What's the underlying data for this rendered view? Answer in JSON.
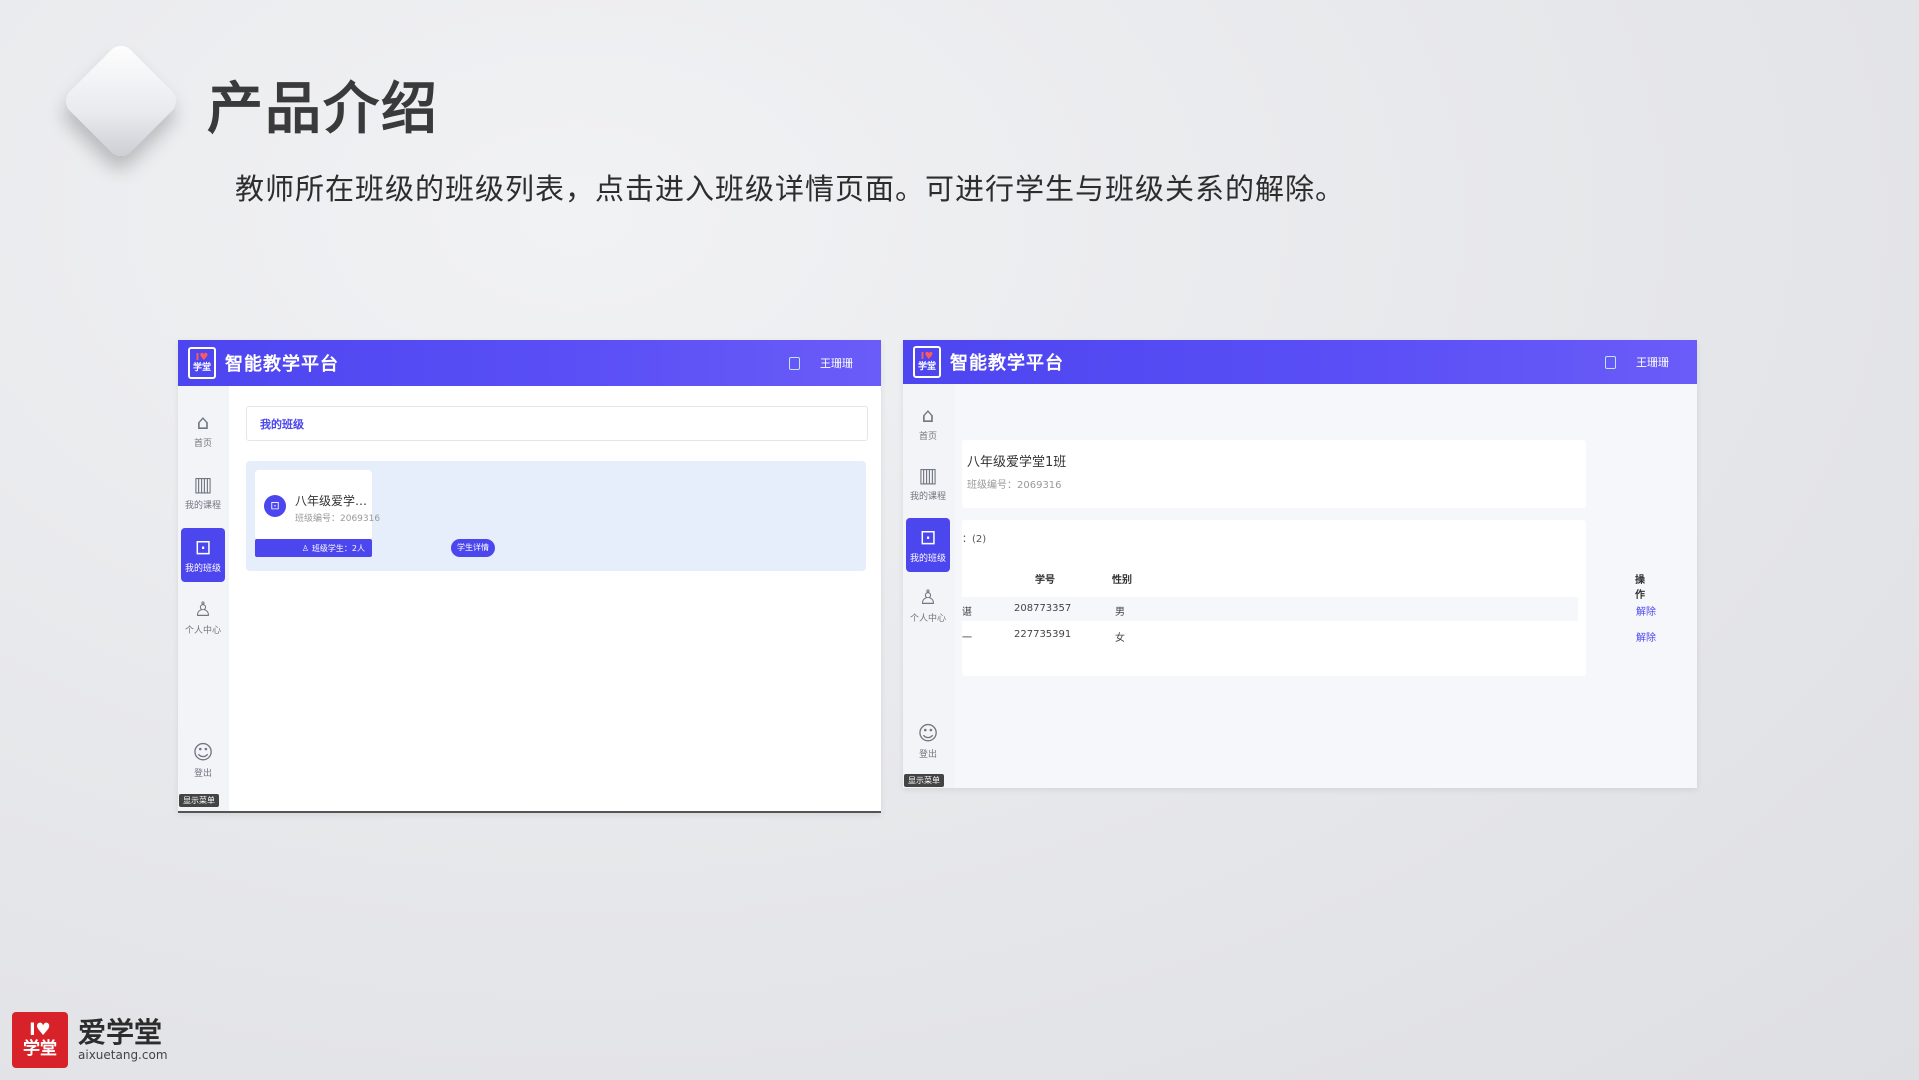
{
  "slide": {
    "title": "产品介绍",
    "subtitle": "教师所在班级的班级列表，点击进入班级详情页面。可进行学生与班级关系的解除。"
  },
  "app": {
    "logo_top": "I♥",
    "logo_bottom": "学堂",
    "name": "智能教学平台",
    "user": "王珊珊"
  },
  "sidebar": {
    "items": [
      {
        "label": "首页",
        "icon": "home-icon"
      },
      {
        "label": "我的课程",
        "icon": "library-icon"
      },
      {
        "label": "我的班级",
        "icon": "classroom-icon"
      },
      {
        "label": "个人中心",
        "icon": "user-icon"
      },
      {
        "label": "登出",
        "icon": "logout-icon"
      }
    ],
    "menu_badge": "显示菜单"
  },
  "class_list": {
    "header": "我的班级",
    "card": {
      "name": "八年级爱学…",
      "code": "班级编号：2069316",
      "students_btn": "班级学生：2人",
      "detail_btn": "学生详情"
    }
  },
  "class_detail": {
    "name": "八年级爱学堂1班",
    "code": "班级编号：2069316",
    "student_count": "：(2)",
    "columns": [
      "学号",
      "性别",
      "操作"
    ],
    "rows": [
      {
        "name": "谌",
        "id": "208773357",
        "gender": "男",
        "action": "解除"
      },
      {
        "name": "一",
        "id": "227735391",
        "gender": "女",
        "action": "解除"
      }
    ]
  },
  "brand": {
    "logo_top": "I♥",
    "logo_bottom": "学堂",
    "name": "爱学堂",
    "url": "aixuetang.com"
  }
}
